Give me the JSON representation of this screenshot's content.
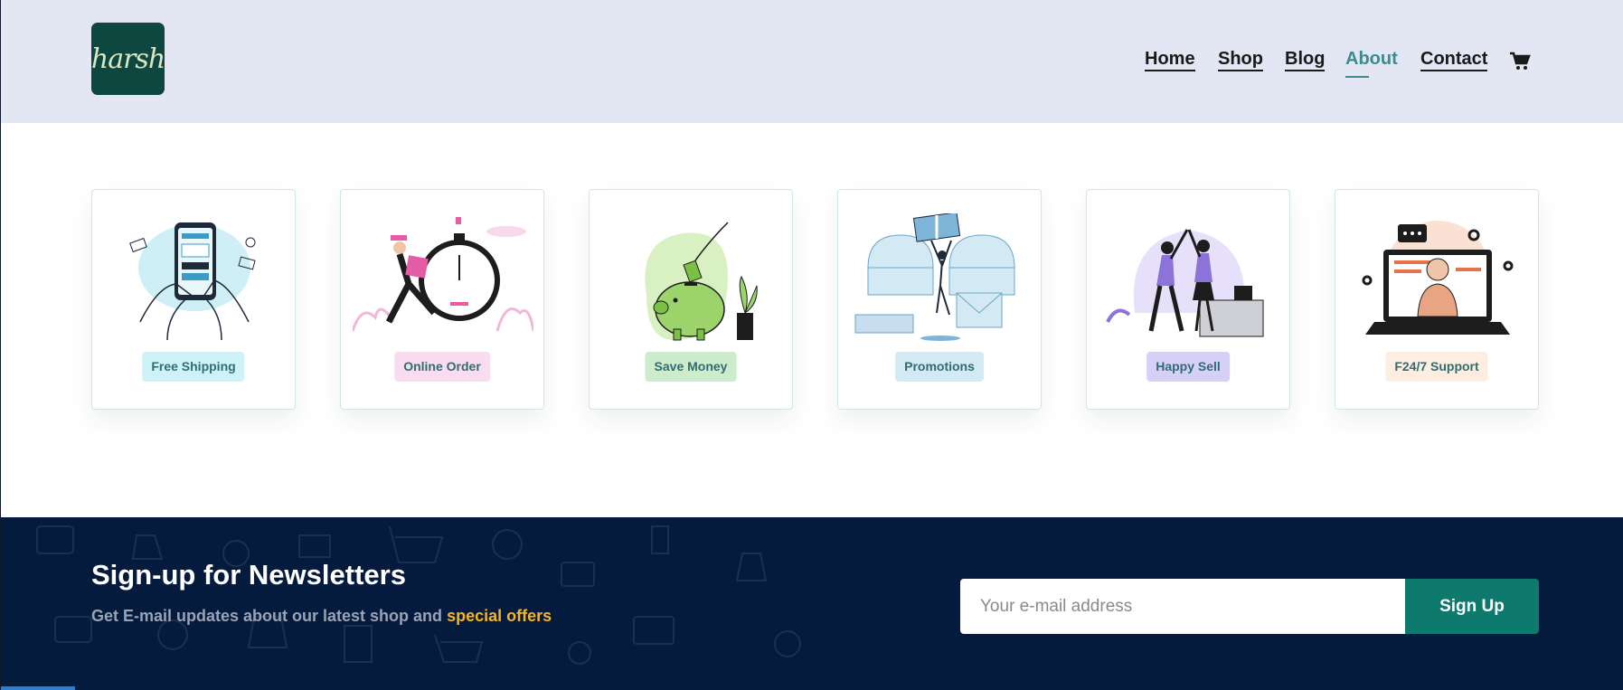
{
  "brand": {
    "logo_text": "harsh"
  },
  "nav": {
    "items": [
      {
        "label": "Home",
        "active": false
      },
      {
        "label": "Shop",
        "active": false
      },
      {
        "label": "Blog",
        "active": false
      },
      {
        "label": "About",
        "active": true
      },
      {
        "label": "Contact",
        "active": false
      }
    ],
    "cart_icon": "cart-icon"
  },
  "features": [
    {
      "label": "Free Shipping",
      "badge_color": "#cdf3f8",
      "icon": "payment-phone-illustration"
    },
    {
      "label": "Online Order",
      "badge_color": "#f9dcf1",
      "icon": "stopwatch-runner-illustration"
    },
    {
      "label": "Save Money",
      "badge_color": "#cdeccb",
      "icon": "piggy-bank-illustration"
    },
    {
      "label": "Promotions",
      "badge_color": "#d3e9f3",
      "icon": "gift-celebration-illustration"
    },
    {
      "label": "Happy Sell",
      "badge_color": "#d6cff8",
      "icon": "high-five-illustration"
    },
    {
      "label": "F24/7 Support",
      "badge_color": "#fdeee1",
      "icon": "support-laptop-illustration"
    }
  ],
  "newsletter": {
    "title": "Sign-up for Newsletters",
    "subtitle_prefix": "Get E-mail updates about our latest shop and",
    "subtitle_highlight": "special offers",
    "email_placeholder": "Your e-mail address",
    "button_label": "Sign Up"
  },
  "colors": {
    "header_bg": "#e3e6f3",
    "accent": "#3d8a8f",
    "newsletter_bg": "#041b3d",
    "highlight": "#f5b423",
    "button": "#0e7a6e"
  }
}
